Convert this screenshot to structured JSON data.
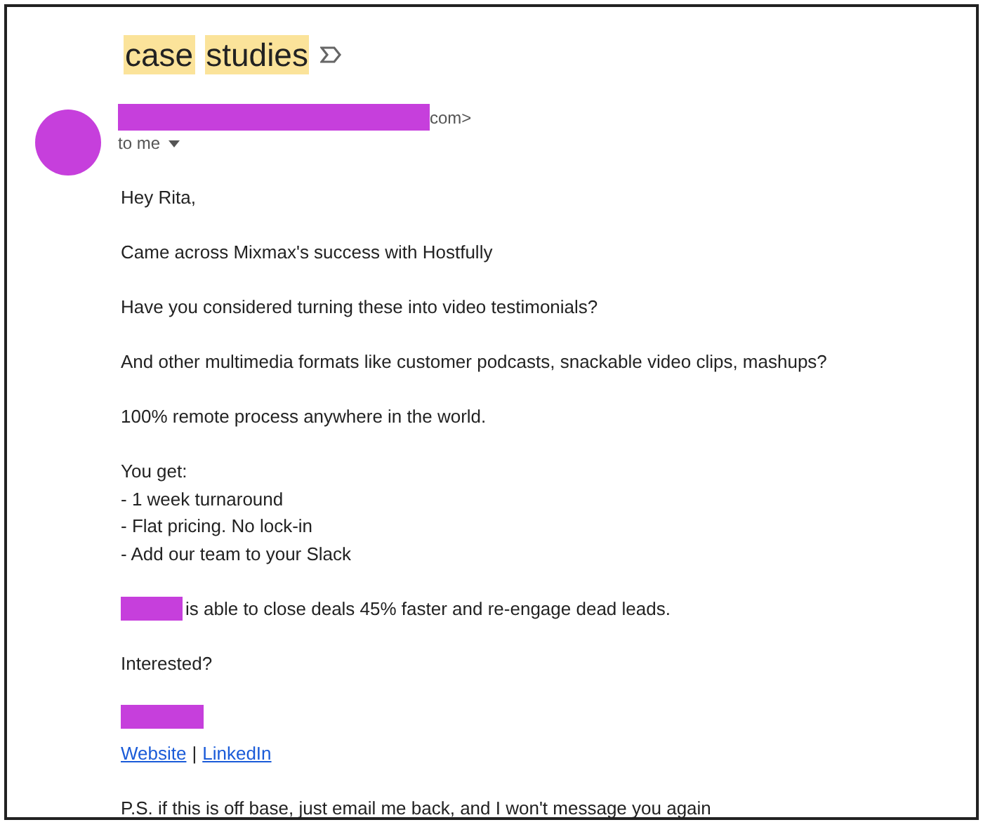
{
  "subject": {
    "words": [
      "case",
      "studies"
    ]
  },
  "sender": {
    "address_end": "com>"
  },
  "recipient": {
    "label": "to me"
  },
  "body": [
    {
      "kind": "text",
      "lines": [
        "Hey Rita,"
      ]
    },
    {
      "kind": "text",
      "lines": [
        "Came across Mixmax's success with Hostfully"
      ]
    },
    {
      "kind": "text",
      "lines": [
        "Have you considered turning these into video testimonials?"
      ]
    },
    {
      "kind": "text",
      "lines": [
        "And other multimedia formats like customer podcasts, snackable video clips, mashups?"
      ]
    },
    {
      "kind": "text",
      "lines": [
        "100% remote process anywhere in the world."
      ]
    },
    {
      "kind": "text",
      "lines": [
        "You get:",
        "- 1 week turnaround",
        "- Flat pricing. No lock-in",
        "- Add our team to your Slack"
      ]
    },
    {
      "kind": "redacted",
      "text": "is able to close deals 45% faster and re-engage dead leads."
    },
    {
      "kind": "text",
      "lines": [
        "Interested?"
      ]
    },
    {
      "kind": "signature",
      "links": [
        "Website",
        "LinkedIn"
      ],
      "separator": "|"
    },
    {
      "kind": "text",
      "lines": [
        "P.S. if this is off base, just email me back, and I won't message you again"
      ]
    }
  ]
}
